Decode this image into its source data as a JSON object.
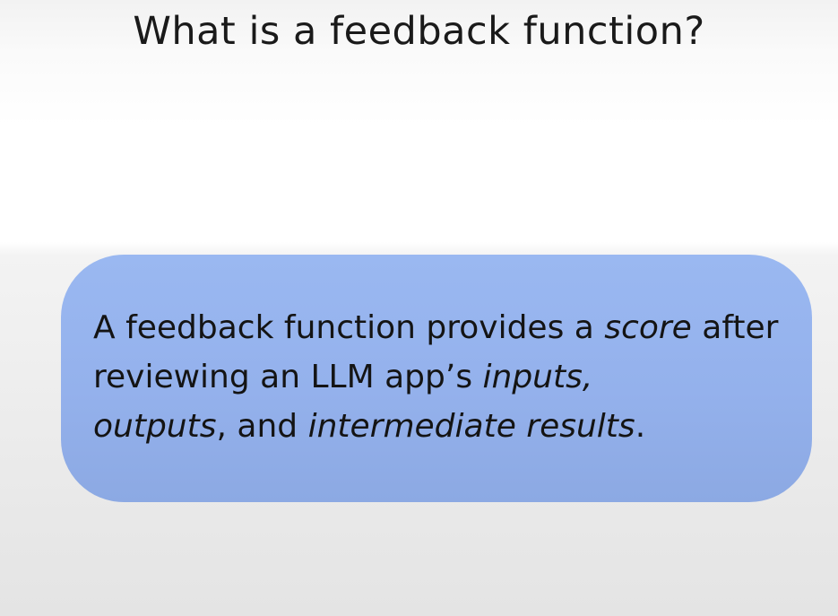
{
  "slide": {
    "title": "What is a feedback function?"
  },
  "callout": {
    "segments": [
      {
        "text": "A feedback function provides a ",
        "italic": false
      },
      {
        "text": "score",
        "italic": true
      },
      {
        "text": " after reviewing an LLM app’s ",
        "italic": false
      },
      {
        "text": "inputs,",
        "italic": true
      },
      {
        "text": " ",
        "italic": false
      },
      {
        "text": "outputs",
        "italic": true
      },
      {
        "text": ", and ",
        "italic": false
      },
      {
        "text": "intermediate results",
        "italic": true
      },
      {
        "text": ".",
        "italic": false
      }
    ]
  },
  "colors": {
    "callout_fill": "#9ab8f1",
    "text": "#141414",
    "background": "#ffffff"
  }
}
